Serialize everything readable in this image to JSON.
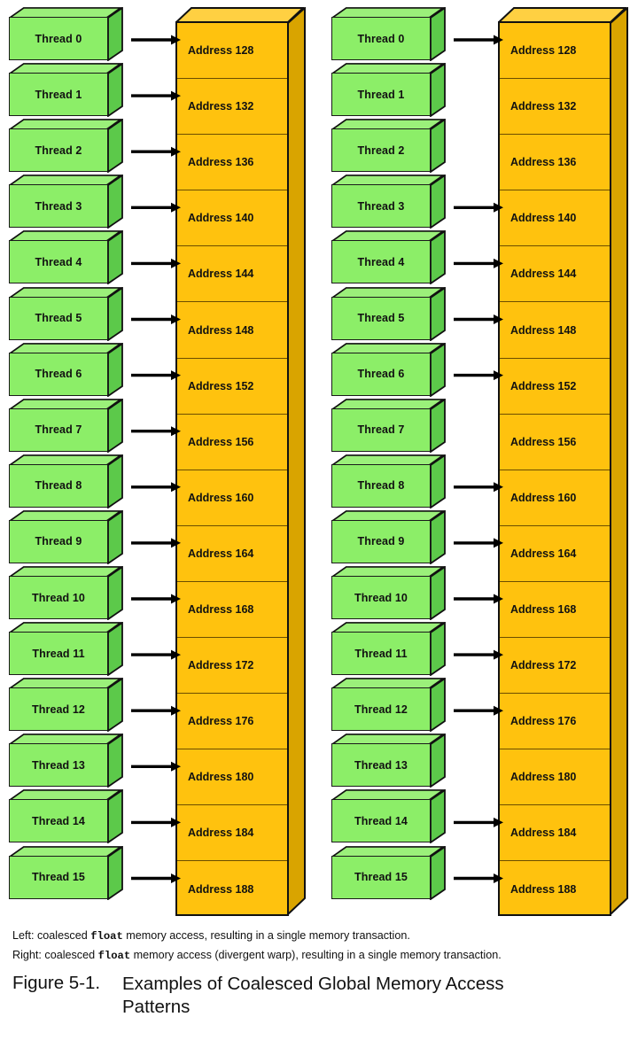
{
  "figure": {
    "number": "Figure 5-1.",
    "title": "Examples of Coalesced Global Memory Access Patterns",
    "caption_left_prefix": "Left: coalesced ",
    "caption_left_mono": "float",
    "caption_left_suffix": " memory access, resulting in a single memory transaction.",
    "caption_right_prefix": "Right: coalesced ",
    "caption_right_mono": "float",
    "caption_right_suffix": " memory access (divergent warp), resulting in a single memory transaction."
  },
  "colors": {
    "thread_front": "#8CEE68",
    "thread_top": "#9BF07A",
    "thread_side": "#5CC94A",
    "memory_front": "#FFC20E",
    "memory_top": "#FFD042",
    "memory_side": "#D9A400",
    "outline": "#111111",
    "cell_divider": "#6B4D00",
    "arrow": "#000000",
    "background": "#FFFFFF"
  },
  "threads": [
    "Thread 0",
    "Thread 1",
    "Thread 2",
    "Thread 3",
    "Thread 4",
    "Thread 5",
    "Thread 6",
    "Thread 7",
    "Thread 8",
    "Thread 9",
    "Thread 10",
    "Thread 11",
    "Thread 12",
    "Thread 13",
    "Thread 14",
    "Thread 15"
  ],
  "addresses": [
    "Address 128",
    "Address 132",
    "Address 136",
    "Address 140",
    "Address 144",
    "Address 148",
    "Address 152",
    "Address 156",
    "Address 160",
    "Address 164",
    "Address 168",
    "Address 172",
    "Address 176",
    "Address 180",
    "Address 184",
    "Address 188"
  ],
  "panels": [
    {
      "id": "left",
      "label": "Left",
      "description": "coalesced float memory access, resulting in a single memory transaction.",
      "arrows": [
        0,
        1,
        2,
        3,
        4,
        5,
        6,
        7,
        8,
        9,
        10,
        11,
        12,
        13,
        14,
        15
      ],
      "no_arrow_threads": []
    },
    {
      "id": "right",
      "label": "Right",
      "description": "coalesced float memory access (divergent warp), resulting in a single memory transaction.",
      "arrows": [
        0,
        3,
        4,
        5,
        6,
        8,
        9,
        10,
        11,
        12,
        14,
        15
      ],
      "no_arrow_threads": [
        1,
        2,
        7,
        13
      ]
    }
  ]
}
